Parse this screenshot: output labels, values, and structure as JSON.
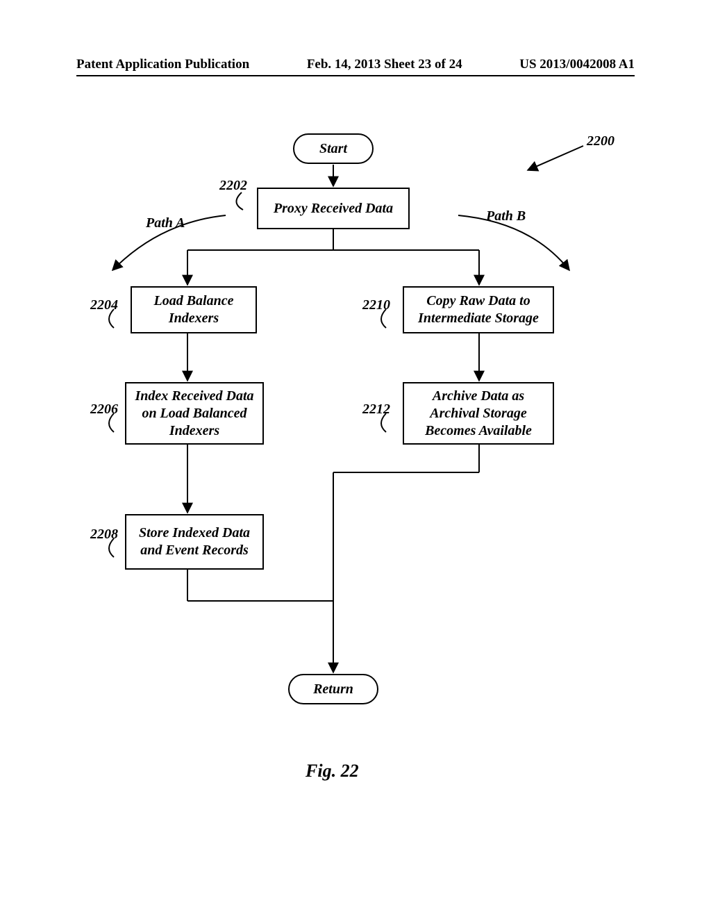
{
  "header": {
    "left": "Patent Application Publication",
    "center": "Feb. 14, 2013  Sheet 23 of 24",
    "right": "US 2013/0042008 A1"
  },
  "chart_data": {
    "type": "flowchart",
    "title": "Fig. 22",
    "figure_ref": "2200",
    "nodes": [
      {
        "id": "start",
        "kind": "terminator",
        "label": "Start"
      },
      {
        "id": "n2202",
        "kind": "process",
        "label": "Proxy Received Data",
        "ref": "2202"
      },
      {
        "id": "n2204",
        "kind": "process",
        "label": "Load Balance Indexers",
        "ref": "2204"
      },
      {
        "id": "n2206",
        "kind": "process",
        "label": "Index Received Data on Load Balanced Indexers",
        "ref": "2206"
      },
      {
        "id": "n2208",
        "kind": "process",
        "label": "Store Indexed Data and Event Records",
        "ref": "2208"
      },
      {
        "id": "n2210",
        "kind": "process",
        "label": "Copy Raw Data to Intermediate Storage",
        "ref": "2210"
      },
      {
        "id": "n2212",
        "kind": "process",
        "label": "Archive Data as Archival Storage Becomes Available",
        "ref": "2212"
      },
      {
        "id": "return",
        "kind": "terminator",
        "label": "Return"
      }
    ],
    "edges": [
      {
        "from": "start",
        "to": "n2202"
      },
      {
        "from": "n2202",
        "to": "n2204",
        "label": "Path A"
      },
      {
        "from": "n2202",
        "to": "n2210",
        "label": "Path B"
      },
      {
        "from": "n2204",
        "to": "n2206"
      },
      {
        "from": "n2206",
        "to": "n2208"
      },
      {
        "from": "n2210",
        "to": "n2212"
      },
      {
        "from": "n2208",
        "to": "return"
      },
      {
        "from": "n2212",
        "to": "return"
      }
    ],
    "path_labels": {
      "a": "Path A",
      "b": "Path B"
    }
  },
  "figure_caption": "Fig. 22"
}
